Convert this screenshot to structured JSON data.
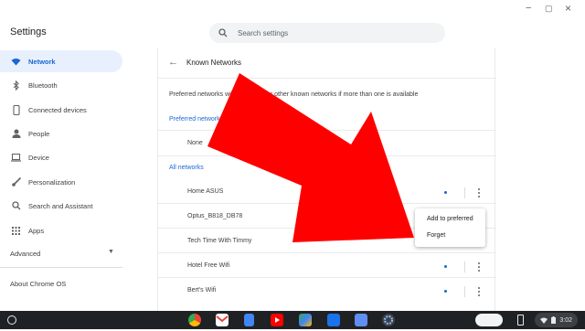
{
  "window": {
    "minimize_glyph": "−",
    "maximize_glyph": "▢",
    "close_glyph": "×"
  },
  "header": {
    "title": "Settings",
    "search_placeholder": "Search settings"
  },
  "sidebar": {
    "items": [
      {
        "label": "Network",
        "icon": "wifi-icon"
      },
      {
        "label": "Bluetooth",
        "icon": "bluetooth-icon"
      },
      {
        "label": "Connected devices",
        "icon": "connected-devices-icon"
      },
      {
        "label": "People",
        "icon": "person-icon"
      },
      {
        "label": "Device",
        "icon": "laptop-icon"
      },
      {
        "label": "Personalization",
        "icon": "brush-icon"
      },
      {
        "label": "Search and Assistant",
        "icon": "search-icon"
      },
      {
        "label": "Apps",
        "icon": "apps-grid-icon"
      },
      {
        "label": "Advanced",
        "icon": "chevron-down-icon"
      }
    ],
    "about": "About Chrome OS"
  },
  "content": {
    "back_glyph": "←",
    "title": "Known Networks",
    "description": "Preferred networks will be used over other known networks if more than one is available",
    "preferred_header": "Preferred networks",
    "preferred_empty": "None",
    "all_header": "All networks",
    "networks": [
      "Home ASUS",
      "Optus_B818_DB78",
      "Tech Time With Timmy",
      "Hotel Free Wifi",
      "Bert's Wifi"
    ]
  },
  "context_menu": {
    "add_preferred": "Add to preferred",
    "forget": "Forget"
  },
  "status_tray": {
    "time": "3:02"
  },
  "colors": {
    "accent": "#1967d2",
    "arrow": "#ff0000",
    "shelf": "#202124"
  }
}
